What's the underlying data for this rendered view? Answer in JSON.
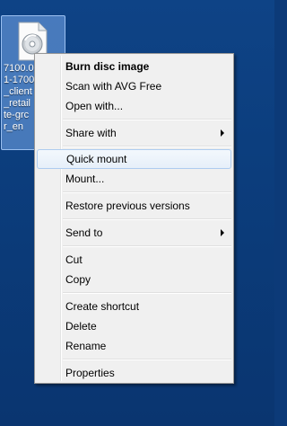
{
  "desktop": {
    "background_color": "#0c3a78",
    "selected_icon": {
      "label_lines": [
        "7100.0",
        "1-1700",
        "_client",
        "_retail",
        "te-grc",
        "r_en"
      ],
      "icon": "disc-image-file-icon"
    }
  },
  "context_menu": {
    "items": [
      {
        "label": "Burn disc image",
        "default": true
      },
      {
        "label": "Scan with AVG Free"
      },
      {
        "label": "Open with..."
      },
      {
        "label": "Share with",
        "submenu": true
      },
      {
        "label": "Quick mount",
        "highlighted": true
      },
      {
        "label": "Mount..."
      },
      {
        "label": "Restore previous versions"
      },
      {
        "label": "Send to",
        "submenu": true
      },
      {
        "label": "Cut"
      },
      {
        "label": "Copy"
      },
      {
        "label": "Create shortcut"
      },
      {
        "label": "Delete"
      },
      {
        "label": "Rename"
      },
      {
        "label": "Properties"
      }
    ],
    "highlight_color": "#aeccef"
  }
}
